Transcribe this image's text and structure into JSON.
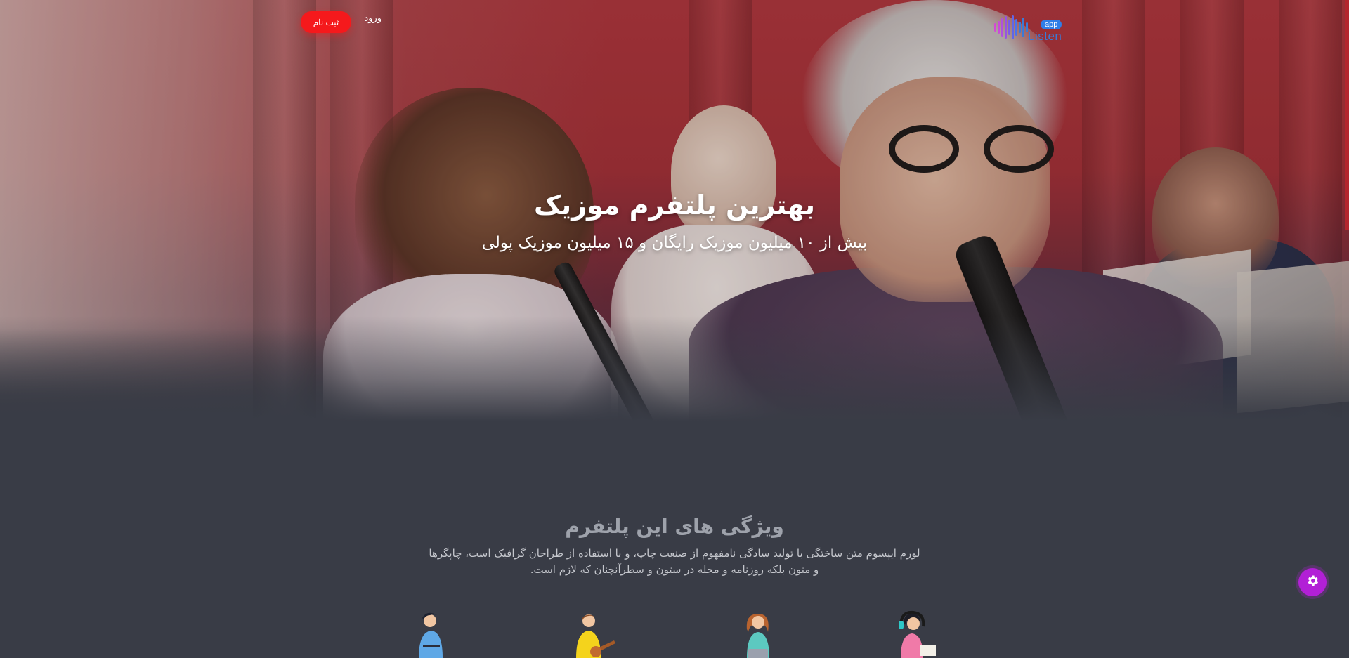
{
  "nav": {
    "logo": {
      "text": "Listen",
      "badge": "app"
    },
    "login_label": "ورود",
    "signup_label": "ثبت نام"
  },
  "hero": {
    "title": "بهترین پلتفرم موزیک",
    "subtitle": "بیش از ۱۰ میلیون موزیک رایگان و ۱۵ میلیون موزیک پولی"
  },
  "features": {
    "title": "ویژگی های این پلتفرم",
    "description": "لورم ایپسوم متن ساختگی با تولید سادگی نامفهوم از صنعت چاپ، و با استفاده از طراحان گرافیک است، چاپگرها و متون بلکه روزنامه و مجله در ستون و سطرآنچنان که لازم است.",
    "illustrations": [
      "person-laptop-illustration",
      "guitar-player-illustration",
      "laptop-user-illustration",
      "headphones-listener-illustration"
    ]
  },
  "colors": {
    "accent": "#f5191c",
    "settings": "#b220d6",
    "background": "#393c46",
    "logo": "#3b7ad6"
  },
  "icons": {
    "settings": "gear-icon"
  }
}
